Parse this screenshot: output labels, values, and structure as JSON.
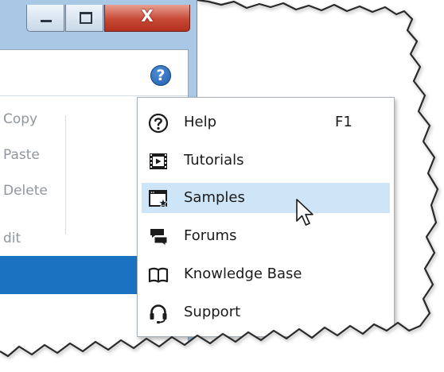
{
  "window": {
    "caption_buttons": {
      "minimize_icon": "minimize-icon",
      "maximize_icon": "maximize-icon",
      "close_glyph": "X"
    },
    "help_button_glyph": "?",
    "ribbon_items": [
      "Copy",
      "Paste",
      "Delete",
      "dit"
    ],
    "colors": {
      "frame": "#a9c8e6",
      "blue_band": "#1b72c0",
      "close": "#c74a36"
    }
  },
  "menu": {
    "items": [
      {
        "label": "Help",
        "shortcut": "F1",
        "icon": "help-circle-icon"
      },
      {
        "label": "Tutorials",
        "shortcut": "",
        "icon": "film-play-icon"
      },
      {
        "label": "Samples",
        "shortcut": "",
        "icon": "window-star-icon",
        "highlighted": true
      },
      {
        "label": "Forums",
        "shortcut": "",
        "icon": "chat-bubbles-icon"
      },
      {
        "label": "Knowledge Base",
        "shortcut": "",
        "icon": "open-book-icon"
      },
      {
        "label": "Support",
        "shortcut": "",
        "icon": "headset-icon"
      }
    ],
    "colors": {
      "highlight": "#cee4f7",
      "text": "#1b1b1b"
    }
  }
}
